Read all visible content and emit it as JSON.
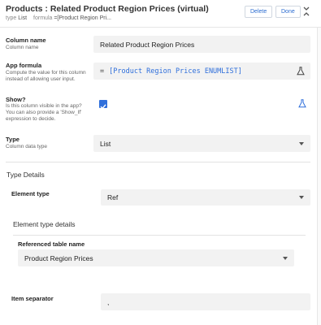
{
  "header": {
    "title": "Products : Related Product Region Prices (virtual)",
    "type_label": "type",
    "type_value": "List",
    "formula_label": "formula",
    "formula_value": "=[Product Region Pri...",
    "delete_label": "Delete",
    "done_label": "Done",
    "collapse_icon": "collapse-icon"
  },
  "column_name": {
    "label": "Column name",
    "sublabel": "Column name",
    "value": "Related Product Region Prices"
  },
  "app_formula": {
    "label": "App formula",
    "sublabel": "Compute the value for this column instead of allowing user input.",
    "prefix": "=",
    "value": "[Product Region Prices ENUMLIST]",
    "icon": "flask-icon"
  },
  "show": {
    "label": "Show?",
    "sublabel": "Is this column visible in the app? You can also provide a 'Show_If' expression to decide.",
    "checked": true,
    "icon": "flask-icon"
  },
  "type": {
    "label": "Type",
    "sublabel": "Column data type",
    "value": "List"
  },
  "type_details": {
    "title": "Type Details",
    "element_type": {
      "label": "Element type",
      "value": "Ref"
    },
    "element_type_details": {
      "title": "Element type details",
      "referenced_table": {
        "label": "Referenced table name",
        "value": "Product Region Prices"
      }
    },
    "item_separator": {
      "label": "Item separator",
      "value": ","
    }
  },
  "colors": {
    "accent": "#2f6fdb",
    "field_bg": "#f2f2f2",
    "divider": "#e3e3e3"
  }
}
